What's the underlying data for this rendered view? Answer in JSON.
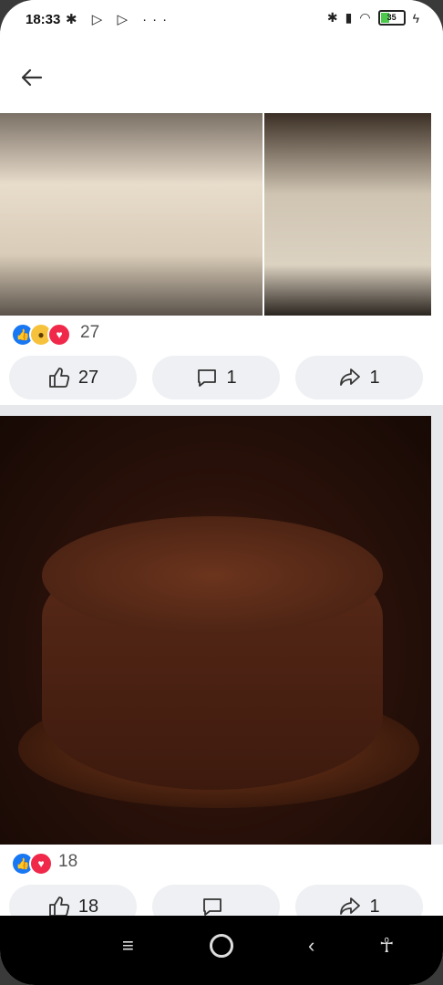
{
  "status_bar": {
    "time": "18:33",
    "left_icons": "✱ ▷ ▷ ···",
    "battery": "35"
  },
  "app_bar": {
    "back_icon": "arrow-left-icon"
  },
  "post1": {
    "reaction_icons": [
      "like-reaction-icon",
      "wow-reaction-icon",
      "love-reaction-icon"
    ],
    "reaction_count": "27",
    "like_count": "27",
    "comment_count": "1",
    "share_count": "1"
  },
  "post2": {
    "reaction_icons": [
      "like-reaction-icon",
      "love-reaction-icon"
    ],
    "reaction_count": "18",
    "like_count": "18",
    "comment_count": "",
    "share_count": "1"
  },
  "nav_bar": {
    "icons": [
      "menu-icon",
      "home-icon",
      "back-icon",
      "accessibility-icon"
    ]
  },
  "colors": {
    "like": "#1877f2",
    "love": "#f02849",
    "wow": "#f7c23b",
    "button_bg": "#eff0f3"
  }
}
